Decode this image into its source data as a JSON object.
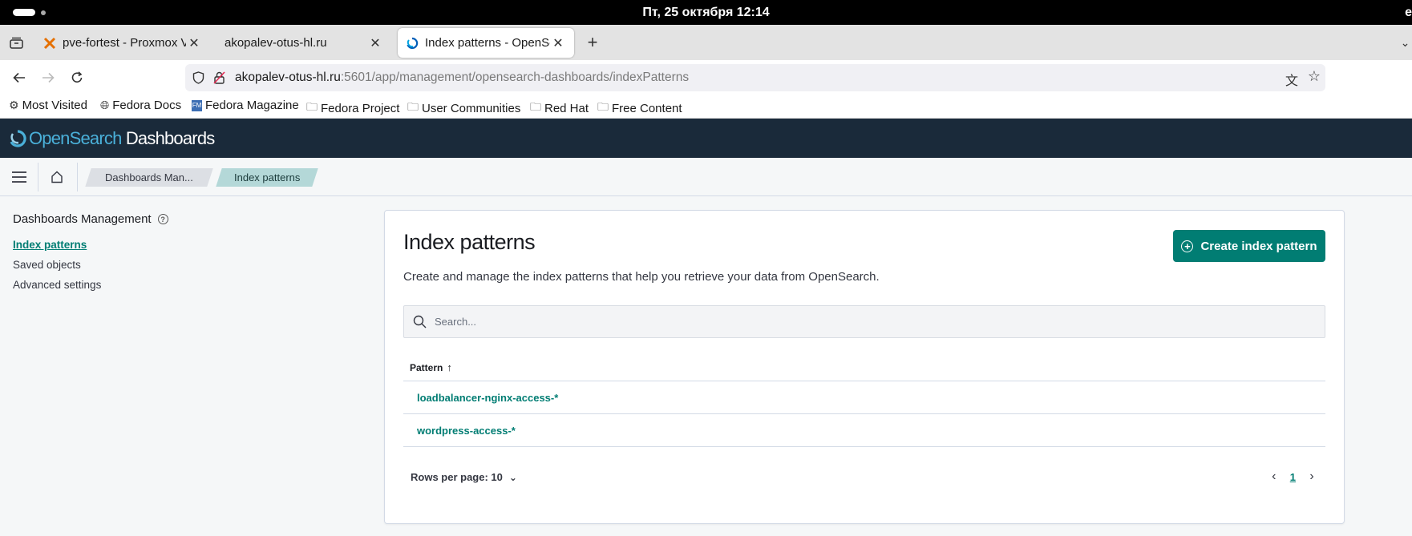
{
  "os": {
    "clock": "Пт, 25 октября  12:14",
    "right_char": "e"
  },
  "browser": {
    "tabs": [
      {
        "label": "pve-fortest - Proxmox Vir",
        "active": false
      },
      {
        "label": "akopalev-otus-hl.ru",
        "active": false
      },
      {
        "label": "Index patterns - OpenSea",
        "active": true
      }
    ],
    "url_host": "akopalev-otus-hl.ru",
    "url_rest": ":5601/app/management/opensearch-dashboards/indexPatterns",
    "bookmarks": [
      {
        "label": "Most Visited",
        "icon": "gear-icon"
      },
      {
        "label": "Fedora Docs",
        "icon": "globe-icon"
      },
      {
        "label": "Fedora Magazine",
        "icon": "fm-icon"
      },
      {
        "label": "Fedora Project",
        "icon": "folder-icon"
      },
      {
        "label": "User Communities",
        "icon": "folder-icon"
      },
      {
        "label": "Red Hat",
        "icon": "folder-icon"
      },
      {
        "label": "Free Content",
        "icon": "folder-icon"
      }
    ]
  },
  "app": {
    "logo_open": "Open",
    "logo_search": "Search",
    "logo_dash": " Dashboards",
    "breadcrumbs": [
      "Dashboards Man...",
      "Index patterns"
    ],
    "sidenav": {
      "title": "Dashboards Management",
      "items": [
        "Index patterns",
        "Saved objects",
        "Advanced settings"
      ]
    },
    "page": {
      "title": "Index patterns",
      "description": "Create and manage the index patterns that help you retrieve your data from OpenSearch.",
      "create_button": "Create index pattern",
      "search_placeholder": "Search...",
      "column_header": "Pattern",
      "rows": [
        "loadbalancer-nginx-access-*",
        "wordpress-access-*"
      ],
      "rows_per_page": "Rows per page: 10",
      "current_page": "1"
    },
    "accent_color": "#017d73",
    "header_color": "#1a2a3a"
  }
}
